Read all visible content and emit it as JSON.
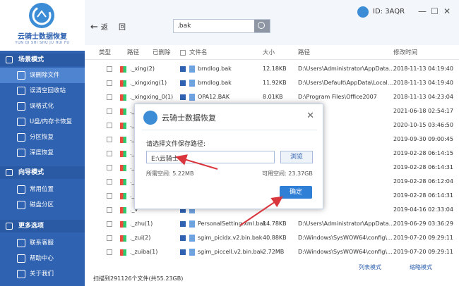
{
  "app": {
    "title": "云骑士数据恢复",
    "subtitle": "YUN QI SHI SHU JU HUI FU",
    "id_label": "ID: 3AQR"
  },
  "sidebar": {
    "sections": [
      {
        "label": "场景模式",
        "items": [
          "误删除文件",
          "误清空回收站",
          "误格式化",
          "U盘/内存卡恢复",
          "分区恢复",
          "深度恢复"
        ]
      },
      {
        "label": "向导模式",
        "items": [
          "常用位置",
          "磁盘分区"
        ]
      },
      {
        "label": "更多选项",
        "items": [
          "联系客服",
          "帮助中心",
          "关于我们"
        ]
      }
    ]
  },
  "toolbar": {
    "back_label": "返",
    "root_label": "回",
    "search_value": ".bak"
  },
  "table": {
    "headers": {
      "type": "类型",
      "path": "路径",
      "deleted": "已删除",
      "name": "文件名",
      "size": "大小",
      "location": "路径",
      "modified": "修改时间"
    },
    "rows": [
      {
        "path": "._xing(2)",
        "name": "brndlog.bak",
        "size": "12.18KB",
        "loc": "D:\\Users\\Administrator\\AppData...",
        "time": "2018-11-13 04:19:40"
      },
      {
        "path": "._xingxing(1)",
        "name": "brndlog.bak",
        "size": "11.92KB",
        "loc": "D:\\Users\\Default\\AppData\\Local...",
        "time": "2018-11-13 04:19:40"
      },
      {
        "path": "._xingxing_0(1)",
        "name": "OPA12.BAK",
        "size": "8.01KB",
        "loc": "D:\\Program Files\\Office2007",
        "time": "2018-11-13 04:23:04"
      },
      {
        "path": "._v",
        "name": "",
        "size": "",
        "loc": "",
        "time": "2021-06-18 02:54:17"
      },
      {
        "path": "._v",
        "name": "",
        "size": "",
        "loc": "",
        "time": "2020-10-15 03:46:50"
      },
      {
        "path": "._v",
        "name": "",
        "size": "",
        "loc": "",
        "time": "2019-09-30 09:00:45"
      },
      {
        "path": "._v",
        "name": "",
        "size": "",
        "loc": "",
        "time": "2019-02-28 06:14:15"
      },
      {
        "path": "._v",
        "name": "",
        "size": "",
        "loc": "",
        "time": "2019-02-28 06:14:31"
      },
      {
        "path": "._v",
        "name": "",
        "size": "",
        "loc": "",
        "time": "2019-02-28 06:12:04"
      },
      {
        "path": "._v",
        "name": "",
        "size": "",
        "loc": "",
        "time": "2019-02-28 06:14:31"
      },
      {
        "path": "._v",
        "name": "",
        "size": "",
        "loc": "",
        "time": "2019-04-16 02:33:04"
      },
      {
        "path": "._zhu(1)",
        "name": "PersonalSetting.xml.bak",
        "size": "14.78KB",
        "loc": "D:\\Users\\Administrator\\AppData...",
        "time": "2019-06-29 03:36:29"
      },
      {
        "path": "._zui(2)",
        "name": "sgim_picidx.v2.bin.bak",
        "size": "40.88KB",
        "loc": "D:\\Windows\\SysWOW64\\config\\...",
        "time": "2019-07-20 09:29:11"
      },
      {
        "path": "._zuiba(1)",
        "name": "sgim_piccell.v2.bin.bak",
        "size": "2.72MB",
        "loc": "D:\\Windows\\SysWOW64\\config\\...",
        "time": "2019-07-20 09:29:11"
      }
    ]
  },
  "status": {
    "scan_text": "扫描到291126个文件(共55.23GB)",
    "list_view": "列表模式",
    "thumb_view": "缩略模式"
  },
  "dialog": {
    "title": "云骑士数据恢复",
    "prompt": "请选择文件保存路径:",
    "path_value": "E:\\云骑士\\",
    "browse_label": "浏览",
    "needed_space": "所需空间: 5.22MB",
    "available_space": "可用空间: 23.37GB",
    "ok_label": "确定"
  },
  "colors": {
    "sidebar": "#2f62b0",
    "accent": "#2f7fd6",
    "arrow": "#d9363e"
  }
}
